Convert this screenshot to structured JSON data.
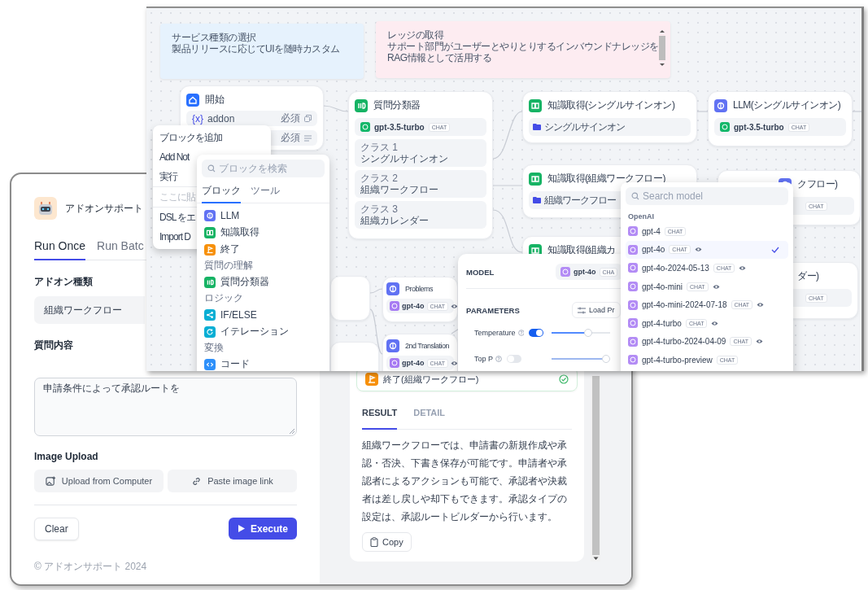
{
  "app_window": {
    "title": "アドオンサポート",
    "tabs": [
      {
        "label": "Run Once",
        "selected": true
      },
      {
        "label": "Run Batc",
        "selected": false
      }
    ],
    "fields": [
      {
        "kind": "select",
        "label": "アドオン種類",
        "value": "組織ワークフロー"
      },
      {
        "kind": "textarea",
        "label": "質問内容",
        "value": "申請条件によって承認ルートを"
      }
    ],
    "image_upload": {
      "label": "Image Upload",
      "buttons": [
        {
          "kind": "upload",
          "label": "Upload from Computer"
        },
        {
          "kind": "link",
          "label": "Paste image link"
        }
      ]
    },
    "actions": [
      {
        "kind": "secondary",
        "label": "Clear"
      },
      {
        "kind": "primary",
        "label": "Execute"
      }
    ],
    "footer": "© アドオンサポート 2024",
    "result_panel": {
      "step": {
        "kind": "end",
        "label": "終了(組織ワークフロー)"
      },
      "tabs": [
        {
          "label": "RESULT",
          "selected": true
        },
        {
          "label": "DETAIL",
          "selected": false
        }
      ],
      "text": "組織ワークフローでは、申請書の新規作成や承認・否決、下書き保存が可能です。申請者や承認者によるアクションも可能で、承認者や決裁者は差し戻しや却下もできます。承認タイプの設定は、承認ルートビルダーから行います。",
      "copy_button": "Copy"
    }
  },
  "workflow_window": {
    "notes": [
      {
        "color": "#e6f2fd",
        "lines": [
          "サービス種類の選択",
          "製品リリースに応じてUIを随時カスタム"
        ]
      },
      {
        "color": "#fdecf1",
        "lines": [
          "レッジの取得",
          "サポート部門がユーザーとやりとりするインバウンドナレッジを",
          "RAG情報として活用する"
        ]
      }
    ],
    "nodes": [
      {
        "kind": "start",
        "title": "開始",
        "variables": [
          {
            "symbol": "{x}",
            "name": "addon",
            "required": "必須",
            "kind": "text"
          },
          {
            "required": "必須",
            "kind": "paragraph"
          }
        ]
      },
      {
        "kind": "classifier",
        "title": "質問分類器",
        "model": {
          "name": "gpt-3.5-turbo",
          "badge": "CHAT",
          "color": "#12b76a"
        },
        "classes": [
          {
            "label": "クラス 1",
            "value": "シングルサインオン"
          },
          {
            "label": "クラス 2",
            "value": "組織ワークフロー"
          },
          {
            "label": "クラス 3",
            "value": "組織カレンダー"
          }
        ]
      },
      {
        "kind": "knowledge",
        "title": "知識取得(シングルサインオン)",
        "dataset": "シングルサインオン"
      },
      {
        "kind": "llm",
        "title": "LLM(シングルサインオン)",
        "model": {
          "name": "gpt-3.5-turbo",
          "badge": "CHAT",
          "color": "#12b76a"
        }
      },
      {
        "kind": "knowledge",
        "title": "知識取得(組織ワークフロー)",
        "dataset": "組織ワークフロー"
      },
      {
        "kind": "llm",
        "title": "クフロー)",
        "model": {
          "badge": "CHAT"
        }
      },
      {
        "kind": "knowledge",
        "title": "知識取得(組織カ"
      },
      {
        "kind": "llm",
        "title": "ダー)",
        "model": {
          "badge": "CHAT"
        }
      },
      {
        "kind": "blank"
      },
      {
        "kind": "llm",
        "title": "Problems",
        "model": {
          "name": "gpt-4o",
          "badge": "CHAT",
          "color": "#a77bf3",
          "vision": true
        }
      },
      {
        "kind": "blank"
      },
      {
        "kind": "llm",
        "title": "2nd Translation",
        "model": {
          "name": "gpt-4o",
          "badge": "CHAT",
          "color": "#a77bf3",
          "vision": true
        }
      }
    ],
    "context_menu": {
      "groups": [
        {
          "items": [
            {
              "label": "ブロックを追加",
              "disabled": false
            },
            {
              "label": "Add Not",
              "disabled": false
            },
            {
              "label": "実行",
              "disabled": false
            }
          ]
        },
        {
          "items": [
            {
              "label": "ここに貼",
              "disabled": true
            }
          ]
        },
        {
          "items": [
            {
              "label": "DSL をエ",
              "disabled": false
            },
            {
              "label": "Import D",
              "disabled": false
            }
          ]
        }
      ]
    },
    "block_picker": {
      "placeholder": "ブロックを検索",
      "tabs": [
        {
          "label": "ブロック",
          "selected": true
        },
        {
          "label": "ツール",
          "selected": false
        }
      ],
      "entries": [
        {
          "kind": "llm",
          "label": "LLM"
        },
        {
          "kind": "knowledge",
          "label": "知識取得"
        },
        {
          "kind": "end",
          "label": "終了"
        },
        {
          "kind": "section",
          "label": "質問の理解"
        },
        {
          "kind": "classifier",
          "label": "質問分類器"
        },
        {
          "kind": "section",
          "label": "ロジック"
        },
        {
          "kind": "ifelse",
          "label": "IF/ELSE"
        },
        {
          "kind": "iteration",
          "label": "イテレーション"
        },
        {
          "kind": "section",
          "label": "変換"
        },
        {
          "kind": "code",
          "label": "コード"
        }
      ]
    },
    "model_settings": {
      "model_label": "MODEL",
      "model": {
        "name": "gpt-4o",
        "badge": "CHA"
      },
      "parameters_label": "PARAMETERS",
      "load_button": "Load Pr",
      "params": [
        {
          "label": "Temperature",
          "on": true,
          "level": 0.62
        },
        {
          "label": "Top P",
          "on": false,
          "level": 0.95
        }
      ]
    },
    "model_dropdown": {
      "placeholder": "Search model",
      "group": "OpenAI",
      "items": [
        {
          "name": "gpt-4",
          "badge": "CHAT",
          "vision": false,
          "selected": false
        },
        {
          "name": "gpt-4o",
          "badge": "CHAT",
          "vision": true,
          "selected": true
        },
        {
          "name": "gpt-4o-2024-05-13",
          "badge": "CHAT",
          "vision": true,
          "selected": false
        },
        {
          "name": "gpt-4o-mini",
          "badge": "CHAT",
          "vision": true,
          "selected": false
        },
        {
          "name": "gpt-4o-mini-2024-07-18",
          "badge": "CHAT",
          "vision": true,
          "selected": false
        },
        {
          "name": "gpt-4-turbo",
          "badge": "CHAT",
          "vision": true,
          "selected": false
        },
        {
          "name": "gpt-4-turbo-2024-04-09",
          "badge": "CHAT",
          "vision": true,
          "selected": false
        },
        {
          "name": "gpt-4-turbo-preview",
          "badge": "CHAT",
          "vision": false,
          "selected": false
        }
      ]
    }
  }
}
